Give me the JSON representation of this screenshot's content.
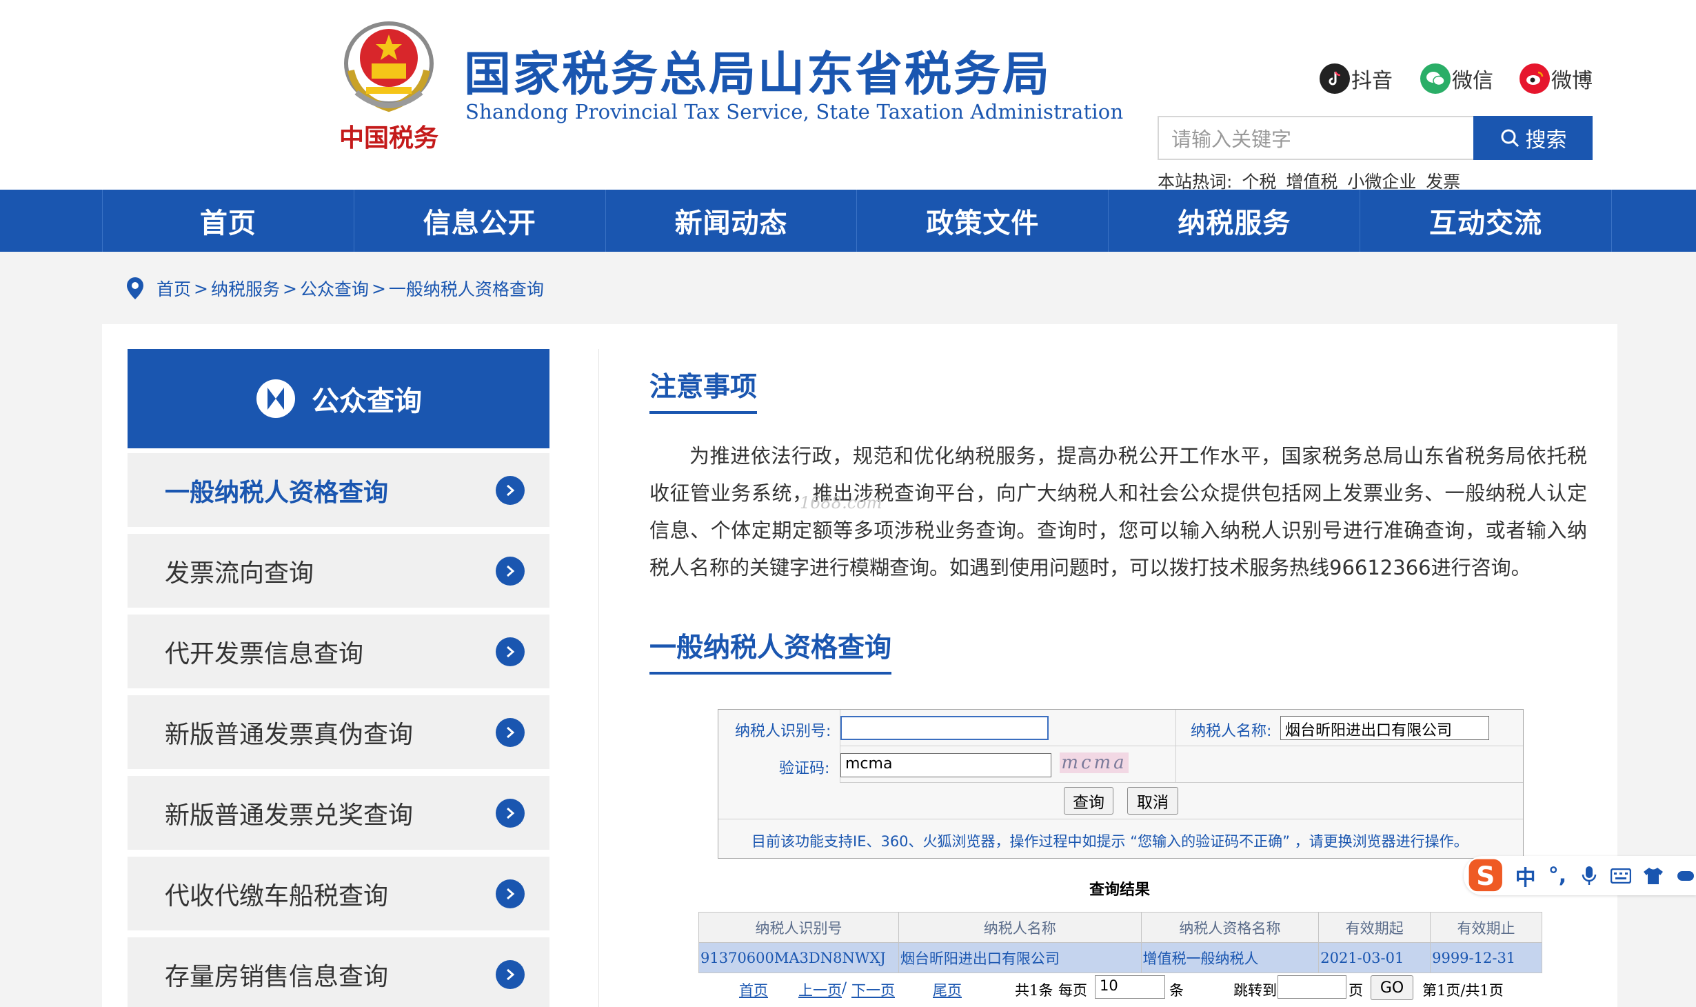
{
  "header": {
    "emblem_text": "中国税务",
    "title": "国家税务总局山东省税务局",
    "subtitle": "Shandong Provincial Tax Service, State Taxation Administration",
    "social": [
      {
        "label": "抖音",
        "icon": "douyin-icon",
        "color": "#222222"
      },
      {
        "label": "微信",
        "icon": "wechat-icon",
        "color": "#2aae67"
      },
      {
        "label": "微博",
        "icon": "weibo-icon",
        "color": "#e6162d"
      }
    ],
    "search": {
      "placeholder": "请输入关键字",
      "button": "搜索"
    },
    "hot": {
      "label": "本站热词:",
      "words": [
        "个税",
        "增值税",
        "小微企业",
        "发票"
      ]
    }
  },
  "nav": [
    "首页",
    "信息公开",
    "新闻动态",
    "政策文件",
    "纳税服务",
    "互动交流"
  ],
  "breadcrumb": [
    "首页",
    "纳税服务",
    "公众查询",
    "一般纳税人资格查询"
  ],
  "sidebar": {
    "title": "公众查询",
    "items": [
      "一般纳税人资格查询",
      "发票流向查询",
      "代开发票信息查询",
      "新版普通发票真伪查询",
      "新版普通发票兑奖查询",
      "代收代缴车船税查询",
      "存量房销售信息查询"
    ]
  },
  "notice": {
    "title": "注意事项",
    "text": "为推进依法行政，规范和优化纳税服务，提高办税公开工作水平，国家税务总局山东省税务局依托税收征管业务系统，推出涉税查询平台，向广大纳税人和社会公众提供包括网上发票业务、一般纳税人认定信息、个体定期定额等多项涉税业务查询。查询时，您可以输入纳税人识别号进行准确查询，或者输入纳税人名称的关键字进行模糊查询。如遇到使用问题时，可以拨打技术服务热线96612366进行咨询。",
    "watermark": "1688.com"
  },
  "query": {
    "title": "一般纳税人资格查询",
    "id_label": "纳税人识别号:",
    "id_value": "",
    "name_label": "纳税人名称:",
    "name_value": "烟台昕阳进出口有限公司",
    "captcha_label": "验证码:",
    "captcha_value": "mcma",
    "captcha_image": "mcma",
    "submit": "查询",
    "cancel": "取消",
    "note": "目前该功能支持IE、360、火狐浏览器，操作过程中如提示 “您输入的验证码不正确” ，请更换浏览器进行操作。"
  },
  "results": {
    "title": "查询结果",
    "columns": [
      "纳税人识别号",
      "纳税人名称",
      "纳税人资格名称",
      "有效期起",
      "有效期止"
    ],
    "rows": [
      [
        "91370600MA3DN8NWXJ",
        "烟台昕阳进出口有限公司",
        "增值税一般纳税人",
        "2021-03-01",
        "9999-12-31"
      ]
    ]
  },
  "pager": {
    "first": "首页",
    "prev": "上一页",
    "slash": "/",
    "next": "下一页",
    "last": "尾页",
    "total": "共1条",
    "per_page_label": "每页",
    "per_page": "10",
    "per_page_unit": "条",
    "goto_label": "跳转到",
    "goto_value": "",
    "goto_unit": "页",
    "go": "GO",
    "page_info": "第1页/共1页"
  },
  "ime": {
    "logo": "S",
    "items": [
      "中",
      "°,",
      "mic-icon",
      "keyboard-icon",
      "skin-icon",
      "game-icon"
    ]
  }
}
